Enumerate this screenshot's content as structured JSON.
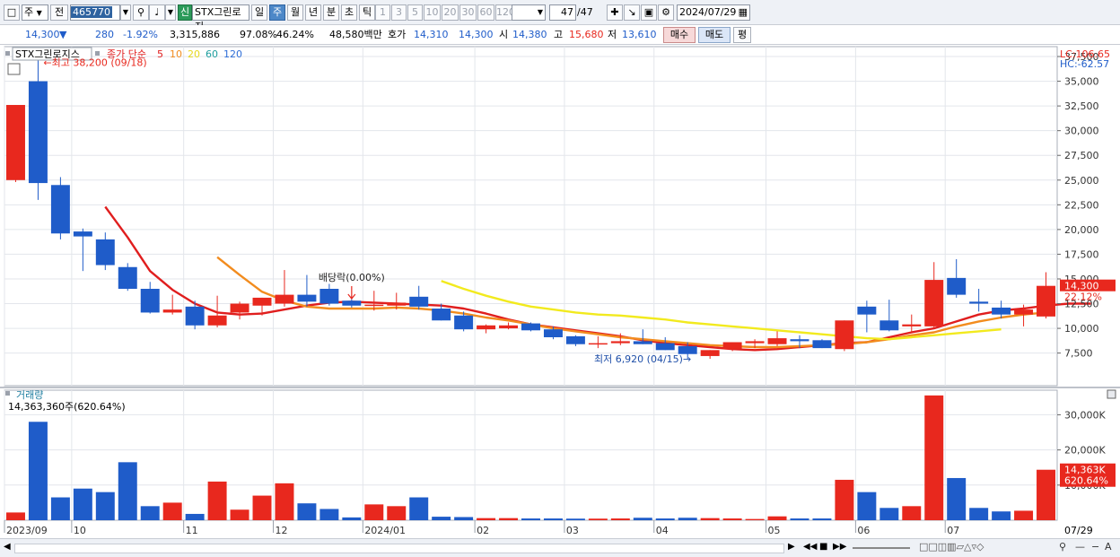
{
  "toolbar": {
    "period_select": "주",
    "prev_label": "전",
    "code_value": "465770",
    "new_label": "신",
    "name_value": "STX그린로지",
    "periods": [
      "일",
      "주",
      "월",
      "년",
      "분",
      "초",
      "틱"
    ],
    "active_period": "주",
    "intervals": [
      "1",
      "3",
      "5",
      "10",
      "20",
      "30",
      "60",
      "120"
    ],
    "count_value": "47",
    "count_total": "/47",
    "date_value": "2024/07/29"
  },
  "quote": {
    "price": "14,300",
    "change_arrow": "▼",
    "change": "280",
    "change_rate": "-1.92%",
    "volume": "3,315,886",
    "ratio1": "97.08%",
    "ratio2": "46.24%",
    "amount": "48,580백만",
    "bid_label": "호가",
    "bid1": "14,310",
    "bid2": "14,300",
    "open_label": "시",
    "open": "14,380",
    "high_label": "고",
    "high": "15,680",
    "low_label": "저",
    "low": "13,610",
    "buy_label": "매수",
    "sell_label": "매도",
    "eval_label": "평"
  },
  "colors": {
    "up": "#e8281e",
    "down": "#1f5cc9",
    "ma5": "#e01e1e",
    "ma10": "#f28c1e",
    "ma20": "#f2ea1e",
    "ma60": "#1e9e9e",
    "ma120": "#2e6ed8"
  },
  "chart_data": [
    {
      "type": "candlestick",
      "title": "STX그린로지스",
      "legend": {
        "label": "종가 단순",
        "items": [
          {
            "name": "5",
            "color": "#e01e1e"
          },
          {
            "name": "10",
            "color": "#f28c1e"
          },
          {
            "name": "20",
            "color": "#f2ea1e"
          },
          {
            "name": "60",
            "color": "#1e9e9e"
          },
          {
            "name": "120",
            "color": "#2e6ed8"
          }
        ]
      },
      "lc_label": "LC:106.65",
      "hc_label": "HC:-62.57",
      "x_ticks": [
        {
          "index": 0,
          "label": "2023/09"
        },
        {
          "index": 3,
          "label": "10"
        },
        {
          "index": 8,
          "label": "11"
        },
        {
          "index": 12,
          "label": "12"
        },
        {
          "index": 16,
          "label": "2024/01"
        },
        {
          "index": 21,
          "label": "02"
        },
        {
          "index": 25,
          "label": "03"
        },
        {
          "index": 29,
          "label": "04"
        },
        {
          "index": 34,
          "label": "05"
        },
        {
          "index": 38,
          "label": "06"
        },
        {
          "index": 42,
          "label": "07"
        }
      ],
      "x_end_label": "07/29",
      "y_ticks": [
        7500,
        10000,
        12500,
        15000,
        17500,
        20000,
        22500,
        25000,
        27500,
        30000,
        32500,
        35000,
        37500
      ],
      "y_tick_labels": [
        "7,500",
        "10,000",
        "12,500",
        "15,000",
        "17,500",
        "20,000",
        "22,500",
        "25,000",
        "27,500",
        "30,000",
        "32,500",
        "35,000",
        "37,500"
      ],
      "ylim": [
        4200,
        38500
      ],
      "candles": [
        {
          "o": 25000,
          "h": 32600,
          "l": 24800,
          "c": 32600
        },
        {
          "o": 35000,
          "h": 38200,
          "l": 23000,
          "c": 24700
        },
        {
          "o": 24500,
          "h": 25300,
          "l": 19000,
          "c": 19600
        },
        {
          "o": 19800,
          "h": 20100,
          "l": 15800,
          "c": 19300
        },
        {
          "o": 19000,
          "h": 19700,
          "l": 15900,
          "c": 16400
        },
        {
          "o": 16200,
          "h": 16600,
          "l": 13800,
          "c": 14000
        },
        {
          "o": 14000,
          "h": 14700,
          "l": 11500,
          "c": 11600
        },
        {
          "o": 11600,
          "h": 13400,
          "l": 11400,
          "c": 11900
        },
        {
          "o": 12200,
          "h": 12800,
          "l": 9900,
          "c": 10300
        },
        {
          "o": 10300,
          "h": 13300,
          "l": 10100,
          "c": 11300
        },
        {
          "o": 11600,
          "h": 12700,
          "l": 10900,
          "c": 12500
        },
        {
          "o": 12300,
          "h": 13100,
          "l": 11300,
          "c": 13100
        },
        {
          "o": 12500,
          "h": 15900,
          "l": 12200,
          "c": 13400
        },
        {
          "o": 13400,
          "h": 15400,
          "l": 12200,
          "c": 12700
        },
        {
          "o": 14000,
          "h": 14500,
          "l": 12300,
          "c": 12500
        },
        {
          "o": 12800,
          "h": 13300,
          "l": 12100,
          "c": 12300
        },
        {
          "o": 12300,
          "h": 13800,
          "l": 11800,
          "c": 12400
        },
        {
          "o": 12300,
          "h": 13600,
          "l": 11900,
          "c": 12600
        },
        {
          "o": 13200,
          "h": 14300,
          "l": 11900,
          "c": 12200
        },
        {
          "o": 12000,
          "h": 12500,
          "l": 10800,
          "c": 10800
        },
        {
          "o": 11300,
          "h": 11700,
          "l": 9700,
          "c": 9900
        },
        {
          "o": 9900,
          "h": 10400,
          "l": 9500,
          "c": 10300
        },
        {
          "o": 10000,
          "h": 10600,
          "l": 9900,
          "c": 10300
        },
        {
          "o": 10500,
          "h": 10600,
          "l": 9700,
          "c": 9800
        },
        {
          "o": 9900,
          "h": 10200,
          "l": 8900,
          "c": 9100
        },
        {
          "o": 9200,
          "h": 9300,
          "l": 8200,
          "c": 8400
        },
        {
          "o": 8400,
          "h": 9200,
          "l": 8000,
          "c": 8500
        },
        {
          "o": 8500,
          "h": 9500,
          "l": 8300,
          "c": 8700
        },
        {
          "o": 8700,
          "h": 9900,
          "l": 8400,
          "c": 8400
        },
        {
          "o": 8500,
          "h": 9100,
          "l": 7800,
          "c": 7800
        },
        {
          "o": 8200,
          "h": 8600,
          "l": 6920,
          "c": 7400
        },
        {
          "o": 7200,
          "h": 7800,
          "l": 6920,
          "c": 7800
        },
        {
          "o": 7900,
          "h": 8600,
          "l": 7700,
          "c": 8600
        },
        {
          "o": 8500,
          "h": 8900,
          "l": 8000,
          "c": 8700
        },
        {
          "o": 8400,
          "h": 9700,
          "l": 8200,
          "c": 9000
        },
        {
          "o": 8900,
          "h": 9300,
          "l": 8000,
          "c": 8700
        },
        {
          "o": 8800,
          "h": 8900,
          "l": 8000,
          "c": 8000
        },
        {
          "o": 7900,
          "h": 10800,
          "l": 7700,
          "c": 10800
        },
        {
          "o": 12200,
          "h": 12800,
          "l": 9600,
          "c": 11400
        },
        {
          "o": 10800,
          "h": 12900,
          "l": 9700,
          "c": 9800
        },
        {
          "o": 10200,
          "h": 11400,
          "l": 9600,
          "c": 10400
        },
        {
          "o": 10200,
          "h": 16700,
          "l": 10000,
          "c": 14900
        },
        {
          "o": 15100,
          "h": 17000,
          "l": 13100,
          "c": 13400
        },
        {
          "o": 12700,
          "h": 14000,
          "l": 11700,
          "c": 12500
        },
        {
          "o": 12100,
          "h": 12800,
          "l": 11000,
          "c": 11400
        },
        {
          "o": 11400,
          "h": 12400,
          "l": 10200,
          "c": 11900
        },
        {
          "o": 11200,
          "h": 15680,
          "l": 11000,
          "c": 14300
        }
      ],
      "ma_series": [
        {
          "name": "5",
          "start": 4,
          "values": [
            22300,
            19200,
            15800,
            13900,
            12500,
            11600,
            11400,
            11500,
            11900,
            12300,
            12600,
            12700,
            12600,
            12500,
            12400,
            12300,
            12000,
            11500,
            10900,
            10400,
            10100,
            9800,
            9500,
            9200,
            8800,
            8500,
            8300,
            8100,
            7900,
            7800,
            7900,
            8100,
            8300,
            8500,
            8600,
            9100,
            9600,
            10000,
            10700,
            11400,
            11800,
            12000,
            12300,
            12500,
            12500
          ]
        },
        {
          "name": "10",
          "start": 9,
          "values": [
            17200,
            15400,
            13700,
            12800,
            12200,
            12000,
            12000,
            12000,
            12100,
            12000,
            11800,
            11500,
            11100,
            10800,
            10400,
            10000,
            9700,
            9400,
            9100,
            8900,
            8700,
            8500,
            8300,
            8200,
            8100,
            8100,
            8200,
            8300,
            8400,
            8600,
            8900,
            9300,
            9600,
            10200,
            10700,
            11100,
            11400,
            11600
          ]
        },
        {
          "name": "20",
          "start": 19,
          "values": [
            14800,
            14000,
            13300,
            12700,
            12200,
            11900,
            11600,
            11400,
            11300,
            11100,
            10900,
            10600,
            10400,
            10200,
            10000,
            9800,
            9600,
            9400,
            9200,
            9000,
            8900,
            9100,
            9300,
            9500,
            9700,
            9900
          ]
        }
      ],
      "annotations": [
        {
          "text": "←최고 38,200 (09/18)",
          "index": 1,
          "value": 38200
        },
        {
          "text": "배당락(0.00%)",
          "index": 15,
          "value": 15000
        },
        {
          "text": "최저 6,920 (04/15)→",
          "index": 30,
          "value": 6920
        }
      ],
      "current_label": "14,300",
      "current_value": 14300,
      "pct_label": "22.12%"
    },
    {
      "type": "bar",
      "title": "거래량",
      "subtitle": "14,363,360주(620.64%)",
      "y_ticks": [
        10000,
        20000,
        30000
      ],
      "y_tick_labels": [
        "10,000K",
        "20,000K",
        "30,000K"
      ],
      "ylim": [
        0,
        37000
      ],
      "values": [
        2200,
        28000,
        6500,
        9000,
        8000,
        16500,
        4000,
        5000,
        1800,
        11000,
        3000,
        7000,
        10500,
        4800,
        3200,
        800,
        4500,
        4000,
        6500,
        1000,
        900,
        600,
        600,
        500,
        500,
        450,
        450,
        500,
        700,
        500,
        700,
        600,
        500,
        350,
        1100,
        500,
        500,
        11500,
        8000,
        3500,
        4000,
        35500,
        12000,
        3500,
        2500,
        2700,
        14363
      ],
      "current_label": "14,363K",
      "pct_label": "620.64%"
    }
  ]
}
